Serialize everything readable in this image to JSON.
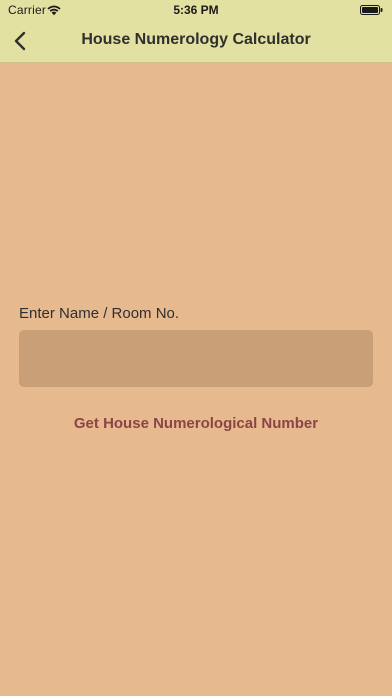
{
  "status_bar": {
    "carrier": "Carrier",
    "time": "5:36 PM",
    "wifi_icon": "wifi-icon",
    "battery_icon": "battery-icon"
  },
  "nav": {
    "title": "House Numerology Calculator",
    "back_icon": "chevron-left-icon"
  },
  "form": {
    "field_label": "Enter Name / Room No.",
    "input_value": "",
    "input_placeholder": "",
    "button_label": "Get House Numerological Number"
  },
  "colors": {
    "background": "#e7b98f",
    "nav_background": "#e3e1a2",
    "input_background": "#c99f77",
    "button_text": "#8b4545"
  }
}
